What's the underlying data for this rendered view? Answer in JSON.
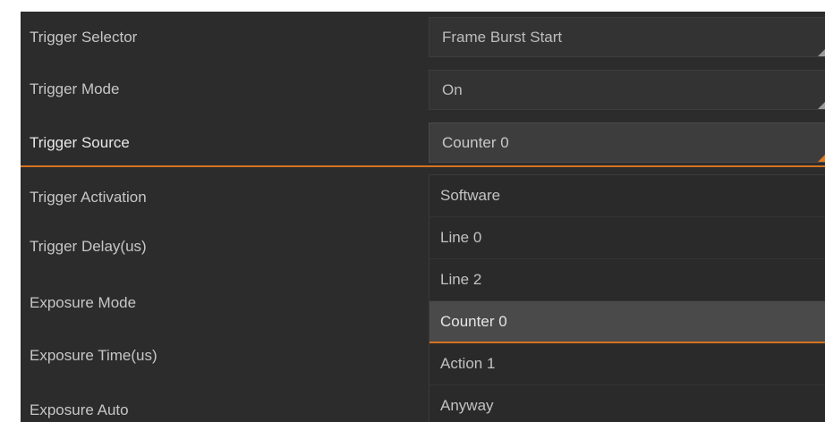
{
  "properties": [
    {
      "label": "Trigger Selector",
      "value": "Frame Burst Start"
    },
    {
      "label": "Trigger Mode",
      "value": "On"
    },
    {
      "label": "Trigger Source",
      "value": "Counter 0"
    },
    {
      "label": "Trigger Activation"
    },
    {
      "label": "Trigger Delay(us)"
    },
    {
      "label": "Exposure Mode"
    },
    {
      "label": "Exposure Time(us)"
    },
    {
      "label": "Exposure Auto"
    }
  ],
  "dropdown": {
    "options": [
      "Software",
      "Line 0",
      "Line 2",
      "Counter 0",
      "Action 1",
      "Anyway"
    ],
    "highlighted": "Counter 0"
  },
  "colors": {
    "accent": "#d4741f",
    "panel_background": "#2c2c2c",
    "text": "#c6c6c6"
  },
  "icons": {
    "dropdown_arrow": "corner-triangle-icon"
  }
}
